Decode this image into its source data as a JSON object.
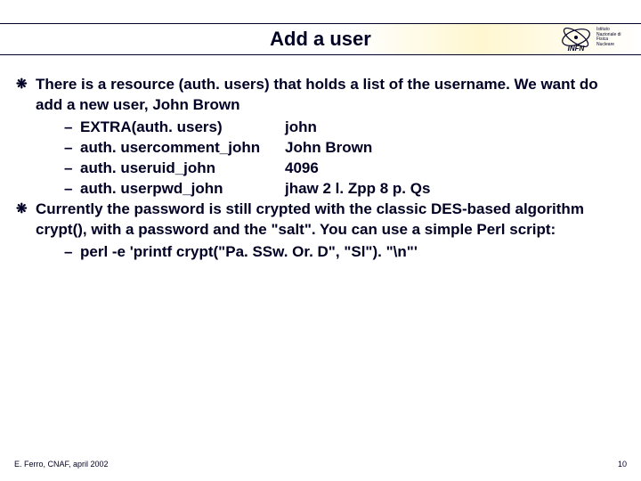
{
  "header": {
    "title": "Add a user",
    "logo_main": "INFN",
    "logo_sub": "Istituto Nazionale di Fisica Nucleare"
  },
  "bullets": [
    {
      "text": "There is a resource (auth. users) that holds a list of the username. We want do add a new user, John Brown",
      "subs": [
        {
          "key": "EXTRA(auth. users)",
          "val": "john"
        },
        {
          "key": "auth. usercomment_john",
          "val": "John Brown"
        },
        {
          "key": "auth. useruid_john",
          "val": "4096"
        },
        {
          "key": "auth. userpwd_john",
          "val": "jhaw 2 l. Zpp 8 p. Qs"
        }
      ]
    },
    {
      "text": "Currently the password is still crypted with the classic DES-based algorithm crypt(), with a password and the \"salt\". You can use a simple Perl script:",
      "subs": [
        {
          "key": "perl -e 'printf crypt(\"Pa. SSw. Or. D\", \"Sl\"). \"\\n\"'",
          "val": ""
        }
      ]
    }
  ],
  "footer": {
    "left": "E. Ferro, CNAF, april 2002",
    "right": "10"
  }
}
